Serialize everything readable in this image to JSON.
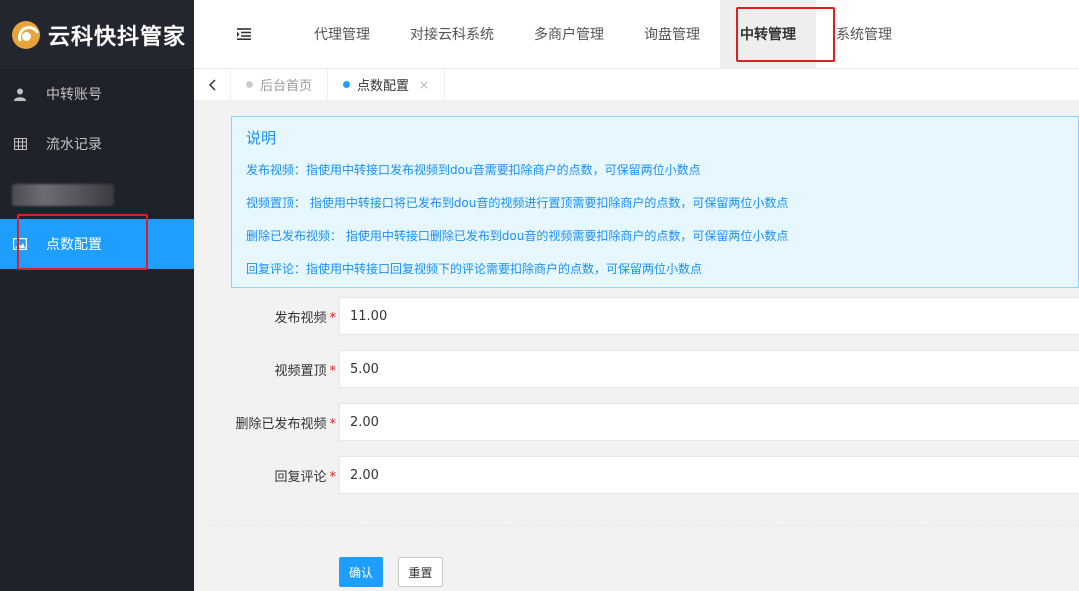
{
  "app": {
    "logo_text": "云科快抖管家"
  },
  "sidebar": {
    "items": [
      {
        "label": "中转账号",
        "icon": "user-icon"
      },
      {
        "label": "流水记录",
        "icon": "grid-icon"
      },
      {
        "label": "",
        "icon": "blurred"
      },
      {
        "label": "点数配置",
        "icon": "picture-icon"
      }
    ]
  },
  "header": {
    "menu_toggle_icon": "menu-indent-icon",
    "nav": [
      {
        "label": "代理管理"
      },
      {
        "label": "对接云科系统"
      },
      {
        "label": "多商户管理"
      },
      {
        "label": "询盘管理"
      },
      {
        "label": "中转管理"
      },
      {
        "label": "系统管理"
      }
    ]
  },
  "tabs": {
    "back_glyph": "‹",
    "items": [
      {
        "label": "后台首页"
      },
      {
        "label": "点数配置",
        "close": "×"
      }
    ]
  },
  "notice": {
    "title": "说明",
    "lines": [
      "发布视频：指使用中转接口发布视频到dou音需要扣除商户的点数，可保留两位小数点",
      "视频置顶： 指使用中转接口将已发布到dou音的视频进行置顶需要扣除商户的点数，可保留两位小数点",
      "删除已发布视频： 指使用中转接口删除已发布到dou音的视频需要扣除商户的点数，可保留两位小数点",
      "回复评论：指使用中转接口回复视频下的评论需要扣除商户的点数，可保留两位小数点"
    ]
  },
  "form": {
    "required_mark": "*",
    "fields": [
      {
        "label": "发布视频",
        "value": "11.00"
      },
      {
        "label": "视频置顶",
        "value": "5.00"
      },
      {
        "label": "删除已发布视频",
        "value": "2.00"
      },
      {
        "label": "回复评论",
        "value": "2.00"
      }
    ],
    "confirm_label": "确认",
    "reset_label": "重置"
  },
  "colors": {
    "accent": "#1e9fff",
    "sidebar_bg": "#20222a",
    "highlight": "#e02020",
    "notice_text": "#1890ff"
  }
}
